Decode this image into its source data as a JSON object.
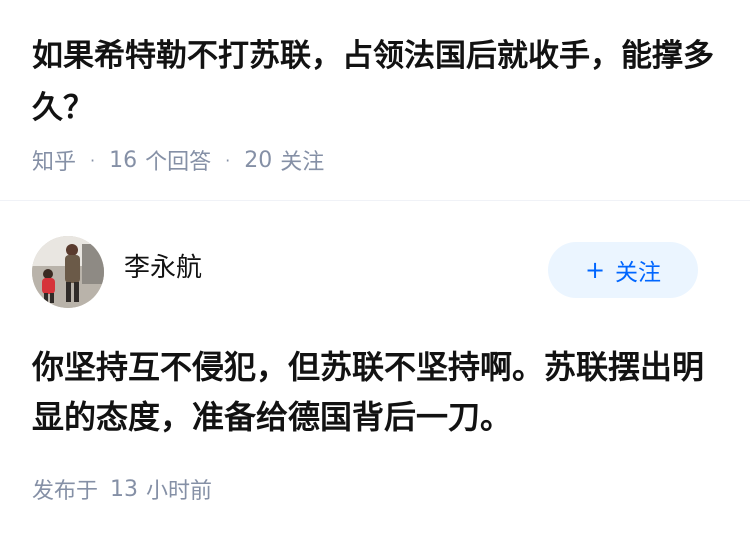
{
  "question": {
    "title": "如果希特勒不打苏联，占领法国后就收手，能撑多久？",
    "source": "知乎",
    "answers_count": "16",
    "answers_label": "个回答",
    "followers_count": "20",
    "followers_label": "关注"
  },
  "answer": {
    "author": {
      "name": "李永航",
      "avatar_icon": "user-avatar-photo"
    },
    "follow_button": {
      "icon": "plus-icon",
      "label": "关注",
      "bg_color": "#ebf5ff",
      "text_color": "#0066ff"
    },
    "content": "你坚持互不侵犯，但苏联不坚持啊。苏联摆出明显的态度，准备给德国背后一刀。",
    "time_prefix": "发布于",
    "time_value": "13",
    "time_unit": "小时前"
  },
  "colors": {
    "text_primary": "#121212",
    "text_meta": "#8590a6",
    "divider": "#f0f2f7"
  }
}
